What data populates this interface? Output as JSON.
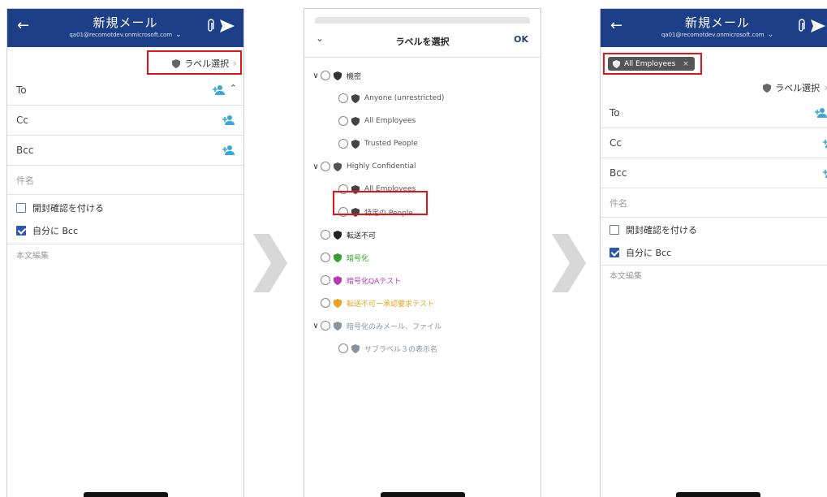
{
  "compose": {
    "title": "新規メール",
    "account": "qa01@recomotdev.onmicrosoft.com",
    "label_button": "ラベル選択",
    "to_label": "To",
    "cc_label": "Cc",
    "bcc_label": "Bcc",
    "subject_placeholder": "件名",
    "read_receipt_label": "開封確認を付ける",
    "bcc_self_label": "自分に Bcc",
    "body_placeholder": "本文編集"
  },
  "picker": {
    "title": "ラベルを選択",
    "ok_label": "OK",
    "labels": [
      {
        "text": "機密",
        "level": 0,
        "expanded": true,
        "color": "#333333"
      },
      {
        "text": "Anyone (unrestricted)",
        "level": 1,
        "color": "#555555"
      },
      {
        "text": "All Employees",
        "level": 1,
        "color": "#555555"
      },
      {
        "text": "Trusted People",
        "level": 1,
        "color": "#555555"
      },
      {
        "text": "Highly Confidential",
        "level": 0,
        "expanded": true,
        "color": "#555555"
      },
      {
        "text": "All Employees",
        "level": 1,
        "color": "#555555"
      },
      {
        "text": "特定の People",
        "level": 1,
        "color": "#555555"
      },
      {
        "text": "転送不可",
        "level": 0,
        "color": "#222222"
      },
      {
        "text": "暗号化",
        "level": 0,
        "color": "#33a12c"
      },
      {
        "text": "暗号化QAテスト",
        "level": 0,
        "color": "#b539b3"
      },
      {
        "text": "転送不可ー承認要求テスト",
        "level": 0,
        "color": "#e5a521"
      },
      {
        "text": "暗号化のみメール、ファイル",
        "level": 0,
        "expanded": true,
        "color": "#8a949c"
      },
      {
        "text": "サブラベル３の表示名",
        "level": 1,
        "color": "#8a949c"
      }
    ]
  },
  "result": {
    "chip_label": "All Employees",
    "chip_close": "×"
  },
  "colors": {
    "header_bg": "#1d3f88",
    "highlight": "#e3131b",
    "add_person": "#3aa8d8",
    "checkbox_on": "#2c56b0"
  },
  "icons": [
    "back-arrow-icon",
    "chevron-down-icon",
    "paperclip-icon",
    "send-icon",
    "shield-icon",
    "add-person-icon",
    "chevron-up-icon",
    "chevron-right-icon",
    "radio-icon",
    "close-icon"
  ]
}
